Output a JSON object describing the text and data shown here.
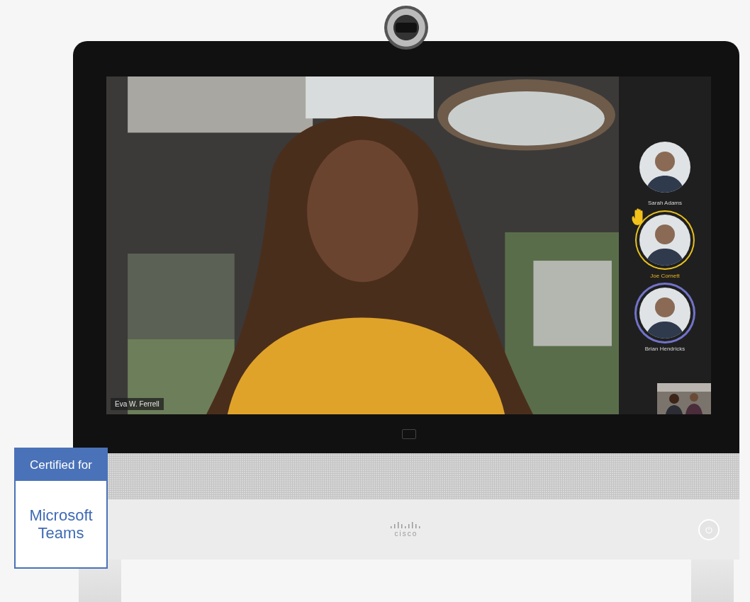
{
  "main_video": {
    "kind": "picture",
    "name_tag": "Eva W. Ferrell"
  },
  "participants": [
    {
      "name": "Sarah Adams",
      "hand_raised": false,
      "speaking": false
    },
    {
      "name": "Joe Cornett",
      "hand_raised": true,
      "speaking": false
    },
    {
      "name": "Brian Hendricks",
      "hand_raised": false,
      "speaking": true
    }
  ],
  "brand": "cisco",
  "badge": {
    "header": "Certified for",
    "product": "Microsoft Teams"
  }
}
